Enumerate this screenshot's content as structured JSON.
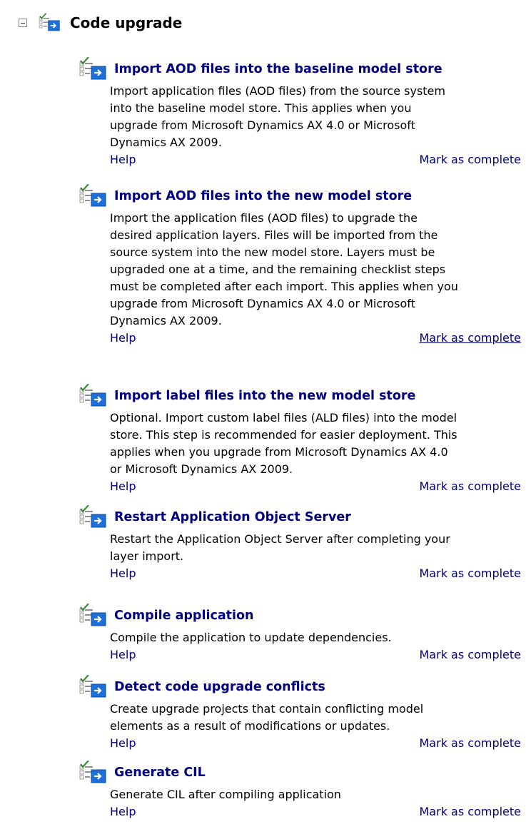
{
  "section": {
    "title": "Code upgrade",
    "toggle_state": "expanded"
  },
  "colors": {
    "link": "#000080",
    "text": "#000000",
    "icon_arrow": "#1e6fd9"
  },
  "steps": [
    {
      "title": "Import AOD files into the baseline model store",
      "description_lines": [
        "Import application files (AOD files) from the source system",
        "into the baseline model store. This applies when you",
        "upgrade from Microsoft Dynamics AX 4.0 or Microsoft",
        "Dynamics AX 2009."
      ],
      "help": "Help",
      "complete": "Mark as complete"
    },
    {
      "title": "Import AOD files into the new model store",
      "description_lines": [
        "Import the application files (AOD files) to upgrade the",
        "desired application layers. Files will be imported from the",
        "source system into the new model store. Layers must be",
        "upgraded one at a time, and the remaining checklist steps",
        "must be completed after each import. This applies when you",
        "upgrade from Microsoft Dynamics AX 4.0 or Microsoft",
        "Dynamics AX 2009."
      ],
      "help": "Help",
      "complete": "Mark as complete"
    },
    {
      "title": "Import label files into the new model store",
      "description_lines": [
        "Optional. Import custom label files (ALD files) into the model",
        "store. This step is recommended for easier deployment. This",
        "applies when you upgrade from Microsoft Dynamics AX 4.0",
        "or Microsoft Dynamics AX 2009."
      ],
      "help": "Help",
      "complete": "Mark as complete"
    },
    {
      "title": "Restart Application Object Server",
      "description_lines": [
        "Restart the Application Object Server after completing your",
        "layer import."
      ],
      "help": "Help",
      "complete": "Mark as complete"
    },
    {
      "title": "Compile application",
      "description_lines": [
        "Compile the application to update dependencies."
      ],
      "help": "Help",
      "complete": "Mark as complete"
    },
    {
      "title": "Detect code upgrade conflicts",
      "description_lines": [
        "Create upgrade projects that contain conflicting model",
        "elements as a result of modifications or updates."
      ],
      "help": "Help",
      "complete": "Mark as complete"
    },
    {
      "title": "Generate CIL",
      "description_lines": [
        "Generate CIL after compiling application"
      ],
      "help": "Help",
      "complete": "Mark as complete"
    }
  ]
}
